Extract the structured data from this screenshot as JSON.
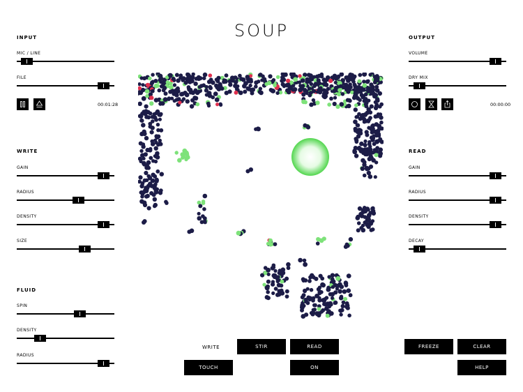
{
  "app": {
    "title": "SOUP"
  },
  "input": {
    "header": "INPUT",
    "mic_label": "MIC / LINE",
    "mic_value": 0.05,
    "file_label": "FILE",
    "file_value": 0.94,
    "buttons": {
      "left_icon": "pause-icon",
      "right_icon": "eject-icon"
    },
    "time": "00:01:28"
  },
  "write": {
    "header": "WRITE",
    "gain_label": "GAIN",
    "gain_value": 0.94,
    "radius_label": "RADIUS",
    "radius_value": 0.65,
    "density_label": "DENSITY",
    "density_value": 0.94,
    "size_label": "SIZE",
    "size_value": 0.72
  },
  "fluid": {
    "header": "FLUID",
    "spin_label": "SPIN",
    "spin_value": 0.67,
    "density_label": "DENSITY",
    "density_value": 0.2,
    "radius_label": "RADIUS",
    "radius_value": 0.94
  },
  "output": {
    "header": "OUTPUT",
    "volume_label": "VOLUME",
    "volume_value": 0.94,
    "drymix_label": "DRY MIX",
    "drymix_value": 0.06,
    "buttons": {
      "record_icon": "record-icon",
      "timer_icon": "hourglass-icon",
      "share_icon": "share-icon"
    },
    "time": "00:00:00"
  },
  "read": {
    "header": "READ",
    "gain_label": "GAIN",
    "gain_value": 0.94,
    "radius_label": "RADIUS",
    "radius_value": 0.94,
    "density_label": "DENSITY",
    "density_value": 0.94,
    "decay_label": "DECAY",
    "decay_value": 0.06
  },
  "bottom": {
    "write_label": "WRITE",
    "stir": "STIR",
    "read": "READ",
    "touch": "TOUCH",
    "on": "ON",
    "freeze": "FREEZE",
    "clear": "CLEAR",
    "help": "HELP"
  },
  "colors": {
    "particle": "#1c1c47",
    "particle_green": "#7ee27a",
    "particle_red": "#e0314f",
    "cursor": "#5ad85a"
  }
}
